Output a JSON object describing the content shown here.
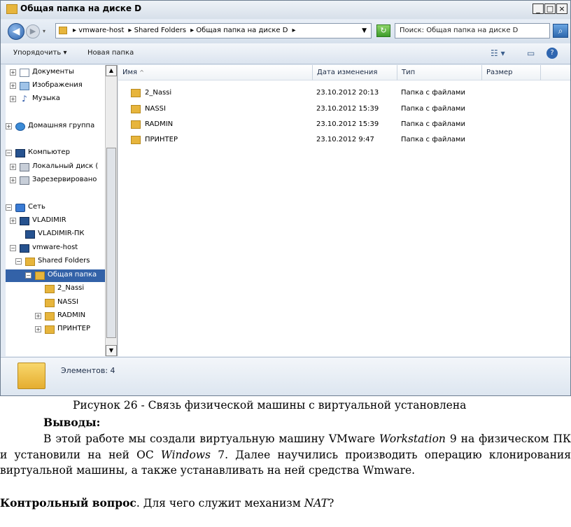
{
  "window": {
    "title": "Общая папка на диске D",
    "buttons": {
      "minimize": "_",
      "maximize": "□",
      "close": "×"
    }
  },
  "address": {
    "crumbs": [
      "▸ vmware-host",
      "▸ Shared Folders",
      "▸ Общая папка на диске D",
      "▸"
    ],
    "search_value": "Поиск: Общая папка на диске D"
  },
  "toolbar": {
    "organize": "Упорядочить ▾",
    "new_folder": "Новая папка"
  },
  "nav_tree": [
    {
      "label": "Документы",
      "expander": "+",
      "icon": "doc"
    },
    {
      "label": "Изображения",
      "expander": "+",
      "icon": "img"
    },
    {
      "label": "Музыка",
      "expander": "+",
      "icon": "music"
    },
    {
      "label": "Домашняя группа",
      "expander": "+",
      "icon": "group"
    },
    {
      "label": "Компьютер",
      "expander": "−",
      "icon": "pc"
    },
    {
      "label": "Локальный диск (",
      "expander": "+",
      "icon": "drive"
    },
    {
      "label": "Зарезервировано",
      "expander": "+",
      "icon": "drive"
    },
    {
      "label": "Сеть",
      "expander": "−",
      "icon": "net"
    },
    {
      "label": "VLADIMIR",
      "expander": "+",
      "icon": "pc"
    },
    {
      "label": "VLADIMIR-ПК",
      "expander": "",
      "icon": "pc"
    },
    {
      "label": "vmware-host",
      "expander": "−",
      "icon": "pc"
    },
    {
      "label": "Shared Folders",
      "expander": "−",
      "icon": "folder"
    },
    {
      "label": "Общая папка",
      "expander": "−",
      "icon": "folder"
    },
    {
      "label": "2_Nassi",
      "expander": "",
      "icon": "folder"
    },
    {
      "label": "NASSI",
      "expander": "",
      "icon": "folder"
    },
    {
      "label": "RADMIN",
      "expander": "+",
      "icon": "folder"
    },
    {
      "label": "ПРИНТЕР",
      "expander": "+",
      "icon": "folder"
    }
  ],
  "columns": {
    "name": "Имя",
    "date": "Дата изменения",
    "type": "Тип",
    "size": "Размер"
  },
  "files": [
    {
      "name": "2_Nassi",
      "date": "23.10.2012 20:13",
      "type": "Папка с файлами"
    },
    {
      "name": "NASSI",
      "date": "23.10.2012 15:39",
      "type": "Папка с файлами"
    },
    {
      "name": "RADMIN",
      "date": "23.10.2012 15:39",
      "type": "Папка с файлами"
    },
    {
      "name": "ПРИНТЕР",
      "date": "23.10.2012 9:47",
      "type": "Папка с файлами"
    }
  ],
  "status": {
    "count": "Элементов: 4"
  },
  "document": {
    "caption": "Рисунок 26 - Связь физической машины с виртуальной установлена",
    "heading": "Выводы:",
    "para_1": "В этой работе мы создали виртуальную машину VMware ",
    "para_em_1": "Workstation",
    "para_2": " 9 на физическом ПК и установили на ней ОС ",
    "para_em_2": "Windows",
    "para_3": " 7. Далее научились производить операцию клонирования виртуальной машины, а также устанавливать на ней средства Wmware.",
    "question_bold": "Контрольный вопрос",
    "question_1": ". Для чего служит механизм ",
    "question_em": "NAT",
    "question_2": "?"
  }
}
